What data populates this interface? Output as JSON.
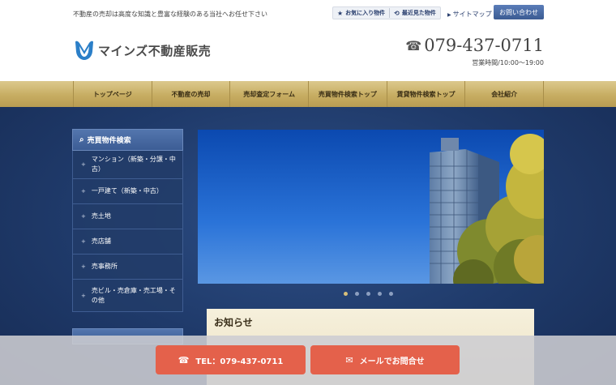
{
  "header": {
    "tagline": "不動産の売却は高度な知識と豊富な経験のある当社へお任せ下さい",
    "favorites_label": "お気に入り物件",
    "recent_label": "最近見た物件",
    "sitemap_label": "サイトマップ",
    "contact_label": "お問い合わせ",
    "logo_text": "マインズ不動産販売",
    "phone": "079-437-0711",
    "hours": "営業時間/10:00〜19:00"
  },
  "nav": {
    "items": [
      "トップページ",
      "不動産の売却",
      "売却査定フォーム",
      "売買物件検索トップ",
      "賃貸物件検索トップ",
      "会社紹介"
    ]
  },
  "sidebar": {
    "title": "売買物件検索",
    "items": [
      "マンション（新築・分譲・中古）",
      "一戸建て（新築・中古）",
      "売土地",
      "売店舗",
      "売事務所",
      "売ビル・売倉庫・売工場・その他"
    ]
  },
  "news": {
    "title": "お知らせ"
  },
  "bottom": {
    "tel_label": "TEL：079-437-0711",
    "mail_label": "メールでお問合せ"
  },
  "colors": {
    "nav_gold": "#c7ad62",
    "main_navy": "#1f3a6a",
    "cta_red": "#e4614b",
    "accent_blue": "#3b5b93"
  },
  "icons": {
    "favorites": "star-icon",
    "recent": "history-icon",
    "phone": "phone-icon",
    "search": "search-icon",
    "mail": "mail-icon"
  }
}
